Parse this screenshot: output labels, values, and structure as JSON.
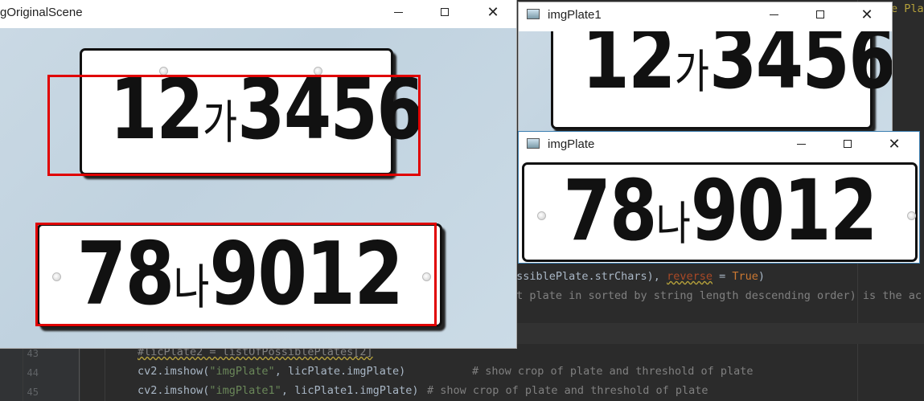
{
  "ide": {
    "line_numbers": [
      "43",
      "44",
      "45"
    ],
    "partial_line_a": {
      "code": "ossiblePlate.strChars), ",
      "param": "reverse",
      "op": " = ",
      "kw": "True",
      "close": ")"
    },
    "partial_line_b": "st plate in sorted by string length descending order) is the ac",
    "line_43": "#licPlate2 = listOfPossiblePlates[2]",
    "line_44": {
      "code_pre": "cv2.imshow(",
      "str": "\"imgPlate\"",
      "code_post": ", licPlate.imgPlate)",
      "comment": "# show crop of plate and threshold of plate"
    },
    "line_45": {
      "code_pre": "cv2.imshow(",
      "str": "\"imgPlate1\"",
      "code_post": ", licPlate1.imgPlate)",
      "comment": "# show crop of plate and threshold of plate"
    },
    "top_right_fragment": "e Pla"
  },
  "windows": {
    "original": {
      "title": "gOriginalScene"
    },
    "plate1": {
      "title": "imgPlate1"
    },
    "plate": {
      "title": "imgPlate"
    }
  },
  "plates": {
    "top": {
      "digits_a": "12",
      "hangul": "가",
      "digits_b": "3456"
    },
    "bottom": {
      "digits_a": "78",
      "hangul": "나",
      "digits_b": "9012"
    }
  },
  "colors": {
    "detection_box": "#e00000",
    "ide_bg": "#2b2b2b",
    "comment": "#808080",
    "string": "#6a8759",
    "keyword": "#cc7832"
  }
}
